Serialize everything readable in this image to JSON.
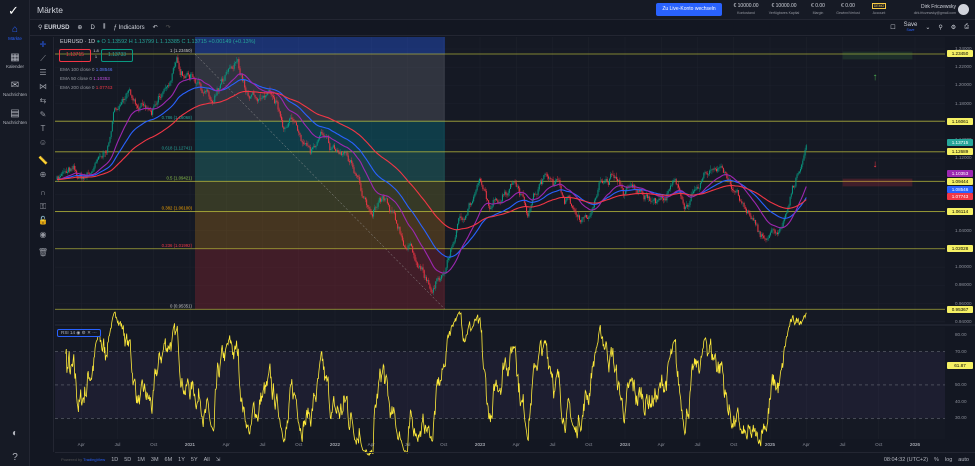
{
  "app": {
    "title": "Märkte",
    "logo": "checkmark-logo"
  },
  "nav": [
    {
      "label": "Märkte",
      "icon": "home-icon",
      "active": true
    },
    {
      "label": "Kalender",
      "icon": "calendar-icon"
    },
    {
      "label": "Nachrichten",
      "icon": "mail-icon"
    },
    {
      "label": "Nachrichten",
      "icon": "news-icon"
    }
  ],
  "account": {
    "live_button": "Zu Live-Konto wechseln",
    "stats": [
      {
        "value": "€ 10000.00",
        "label": "Kontostand"
      },
      {
        "value": "€ 10000.00",
        "label": "Verfügbares Kapital"
      },
      {
        "value": "€ 0.00",
        "label": "Margin"
      },
      {
        "value": "€ 0.00",
        "label": "Gewinn/Verlust"
      },
      {
        "value": "DEMO",
        "label": "Account"
      }
    ],
    "user_name": "Dirk Friczewsky",
    "user_email": "dirk.friczewsky@gmail.com"
  },
  "toolbar": {
    "symbol": "EURUSD",
    "interval": "D",
    "indicators": "Indicators",
    "save": "Save",
    "save_sub": "Save"
  },
  "legend": {
    "title": "EURUSD · 1D",
    "ohlc": "O 1.13592  H 1.13799  L 1.13385  C 1.13715  +0.00149 (+0.13%)",
    "sell": "1.13715",
    "spread_top": "1.8",
    "spread_bottom": "1",
    "buy": "1.13733",
    "emas": [
      {
        "label": "EMA 100 close 0",
        "value": "1.08546",
        "color": "#2962ff"
      },
      {
        "label": "EMA 50 close 0",
        "value": "1.10353",
        "color": "#9c27b0"
      },
      {
        "label": "EMA 200 close 0",
        "value": "1.07743",
        "color": "#f23645"
      }
    ]
  },
  "rsi": {
    "label": "RSI",
    "length": "14",
    "value": "61.87",
    "ticks": [
      "80.00",
      "70.00",
      "60.00",
      "50.00",
      "40.00",
      "30.00"
    ]
  },
  "colors": {
    "up": "#089981",
    "down": "#f23645",
    "fib_line": "#c8c83c",
    "rsi": "#ffeb3b",
    "accent": "#2962ff"
  },
  "chart_data": {
    "type": "candlestick",
    "symbol": "EURUSD",
    "interval": "1D",
    "ylim": [
      0.94,
      1.24
    ],
    "yticks": [
      "1.24000",
      "1.22000",
      "1.20000",
      "1.18000",
      "1.16000",
      "1.14000",
      "1.12000",
      "1.10000",
      "1.08000",
      "1.06000",
      "1.04000",
      "1.02000",
      "1.00000",
      "0.98000",
      "0.96000",
      "0.94000"
    ],
    "xticks": [
      "Apr",
      "Jul",
      "Oct",
      "2021",
      "Apr",
      "Jul",
      "Oct",
      "2022",
      "Apr",
      "Jul",
      "Oct",
      "2023",
      "Apr",
      "Jul",
      "Oct",
      "2024",
      "Apr",
      "Jul",
      "Oct",
      "2025",
      "Apr",
      "Jul",
      "Oct",
      "2026"
    ],
    "monthly_close": {
      "start": "2020-02",
      "values": [
        1.1,
        1.103,
        1.094,
        1.11,
        1.123,
        1.178,
        1.193,
        1.172,
        1.165,
        1.195,
        1.222,
        1.213,
        1.207,
        1.173,
        1.202,
        1.222,
        1.186,
        1.187,
        1.18,
        1.158,
        1.156,
        1.133,
        1.137,
        1.123,
        1.121,
        1.107,
        1.054,
        1.073,
        1.048,
        1.022,
        1.005,
        0.975,
        0.988,
        1.04,
        1.07,
        1.086,
        1.058,
        1.084,
        1.102,
        1.069,
        1.091,
        1.102,
        1.084,
        1.057,
        1.058,
        1.091,
        1.104,
        1.082,
        1.08,
        1.079,
        1.072,
        1.085,
        1.071,
        1.082,
        1.105,
        1.112,
        1.088,
        1.057,
        1.035,
        1.036,
        1.037,
        1.081,
        1.137
      ]
    },
    "fibonacci": [
      {
        "ratio": "1",
        "price": "1.23450"
      },
      {
        "ratio": "0.786",
        "price": "1.16068"
      },
      {
        "ratio": "0.618",
        "price": "1.12741"
      },
      {
        "ratio": "0.5",
        "price": "1.09421"
      },
      {
        "ratio": "0.382",
        "price": "1.06100"
      },
      {
        "ratio": "0.236",
        "price": "1.01992"
      },
      {
        "ratio": "0",
        "price": "0.95351"
      }
    ],
    "price_labels": [
      {
        "v": "1.23450",
        "c": "#f5f064"
      },
      {
        "v": "1.16061",
        "c": "#f5f064"
      },
      {
        "v": "1.13715",
        "c": "#26a69a"
      },
      {
        "v": "1.12689",
        "c": "#f5f064"
      },
      {
        "v": "1.10353",
        "c": "#9c27b0"
      },
      {
        "v": "1.09444",
        "c": "#f5f064"
      },
      {
        "v": "1.08546",
        "c": "#2962ff"
      },
      {
        "v": "1.07743",
        "c": "#f23645"
      },
      {
        "v": "1.06114",
        "c": "#f5f064"
      },
      {
        "v": "1.02028",
        "c": "#f5f064"
      },
      {
        "v": "0.95367",
        "c": "#f5f064"
      }
    ],
    "emas": [
      100,
      50,
      200
    ]
  },
  "bottom": {
    "powered_prefix": "Powered by",
    "powered_link": "TradingView",
    "ranges": [
      "1D",
      "5D",
      "1M",
      "3M",
      "6M",
      "1Y",
      "5Y",
      "All"
    ],
    "time": "08:04:32 (UTC+2)",
    "pct": "%",
    "log": "log",
    "auto": "auto"
  }
}
